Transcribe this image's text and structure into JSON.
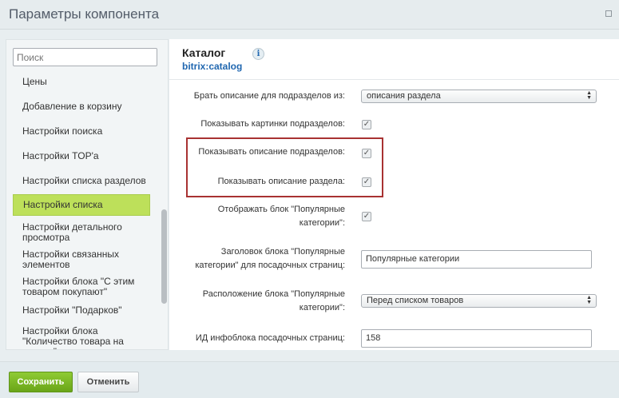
{
  "window": {
    "title": "Параметры компонента"
  },
  "sidebar": {
    "search_placeholder": "Поиск",
    "items": [
      {
        "label": "Цены"
      },
      {
        "label": "Добавление в корзину"
      },
      {
        "label": "Настройки поиска"
      },
      {
        "label": "Настройки TOP'а"
      },
      {
        "label": "Настройки списка разделов"
      },
      {
        "label": "Настройки списка",
        "active": true
      },
      {
        "label": "Настройки детального просмотра"
      },
      {
        "label": "Настройки связанных элементов"
      },
      {
        "label": "Настройки блока \"С этим товаром покупают\""
      },
      {
        "label": "Настройки \"Подарков\""
      },
      {
        "label": "Настройки блока \"Количество товара на складе\""
      }
    ]
  },
  "main": {
    "title": "Каталог",
    "subtitle": "bitrix:catalog",
    "info_icon": "i",
    "fields": [
      {
        "label": "Брать описание для подразделов из:",
        "type": "select",
        "value": "описания раздела"
      },
      {
        "label": "Показывать картинки подразделов:",
        "type": "checkbox",
        "checked": true
      },
      {
        "label": "Показывать описание подразделов:",
        "type": "checkbox",
        "checked": true
      },
      {
        "label": "Показывать описание раздела:",
        "type": "checkbox",
        "checked": true
      },
      {
        "label_line1": "Отображать блок \"Популярные",
        "label_line2": "категории\":",
        "type": "checkbox",
        "checked": true
      },
      {
        "label_line1": "Заголовок блока \"Популярные",
        "label_line2": "категории\" для посадочных страниц:",
        "type": "text",
        "value": "Популярные категории"
      },
      {
        "label_line1": "Расположение блока \"Популярные",
        "label_line2": "категории\":",
        "type": "select",
        "value": "Перед списком товаров"
      },
      {
        "label": "ИД инфоблока посадочных страниц:",
        "type": "text",
        "value": "158"
      }
    ],
    "checkmark": "✓",
    "select_arrows": "▲▼"
  },
  "footer": {
    "save_label": "Сохранить",
    "cancel_label": "Отменить"
  },
  "colors": {
    "highlight": "#a83232",
    "active_item": "#bde05a",
    "save_button": "#7cb928",
    "link": "#2067b0"
  }
}
